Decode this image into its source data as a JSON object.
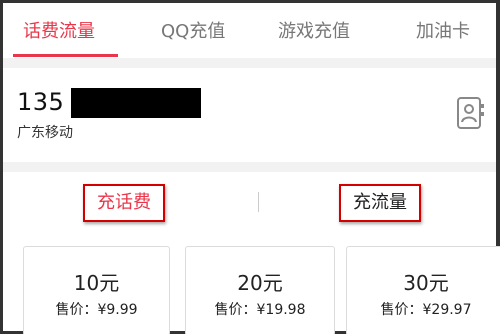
{
  "tabs": [
    {
      "label": "话费流量",
      "active": true
    },
    {
      "label": "QQ充值",
      "active": false
    },
    {
      "label": "游戏充值",
      "active": false
    },
    {
      "label": "加油卡",
      "active": false
    }
  ],
  "phone": {
    "number_prefix": "135",
    "carrier": "广东移动",
    "contact_icon": "contact-book-icon"
  },
  "recharge_types": {
    "call_fee": "充话费",
    "data_plan": "充流量"
  },
  "amounts": [
    {
      "value": "10元",
      "price": "售价：¥9.99"
    },
    {
      "value": "20元",
      "price": "售价：¥19.98"
    },
    {
      "value": "30元",
      "price": "售价：¥29.97"
    }
  ],
  "colors": {
    "accent": "#e8374a",
    "highlight_box": "#d40000"
  }
}
